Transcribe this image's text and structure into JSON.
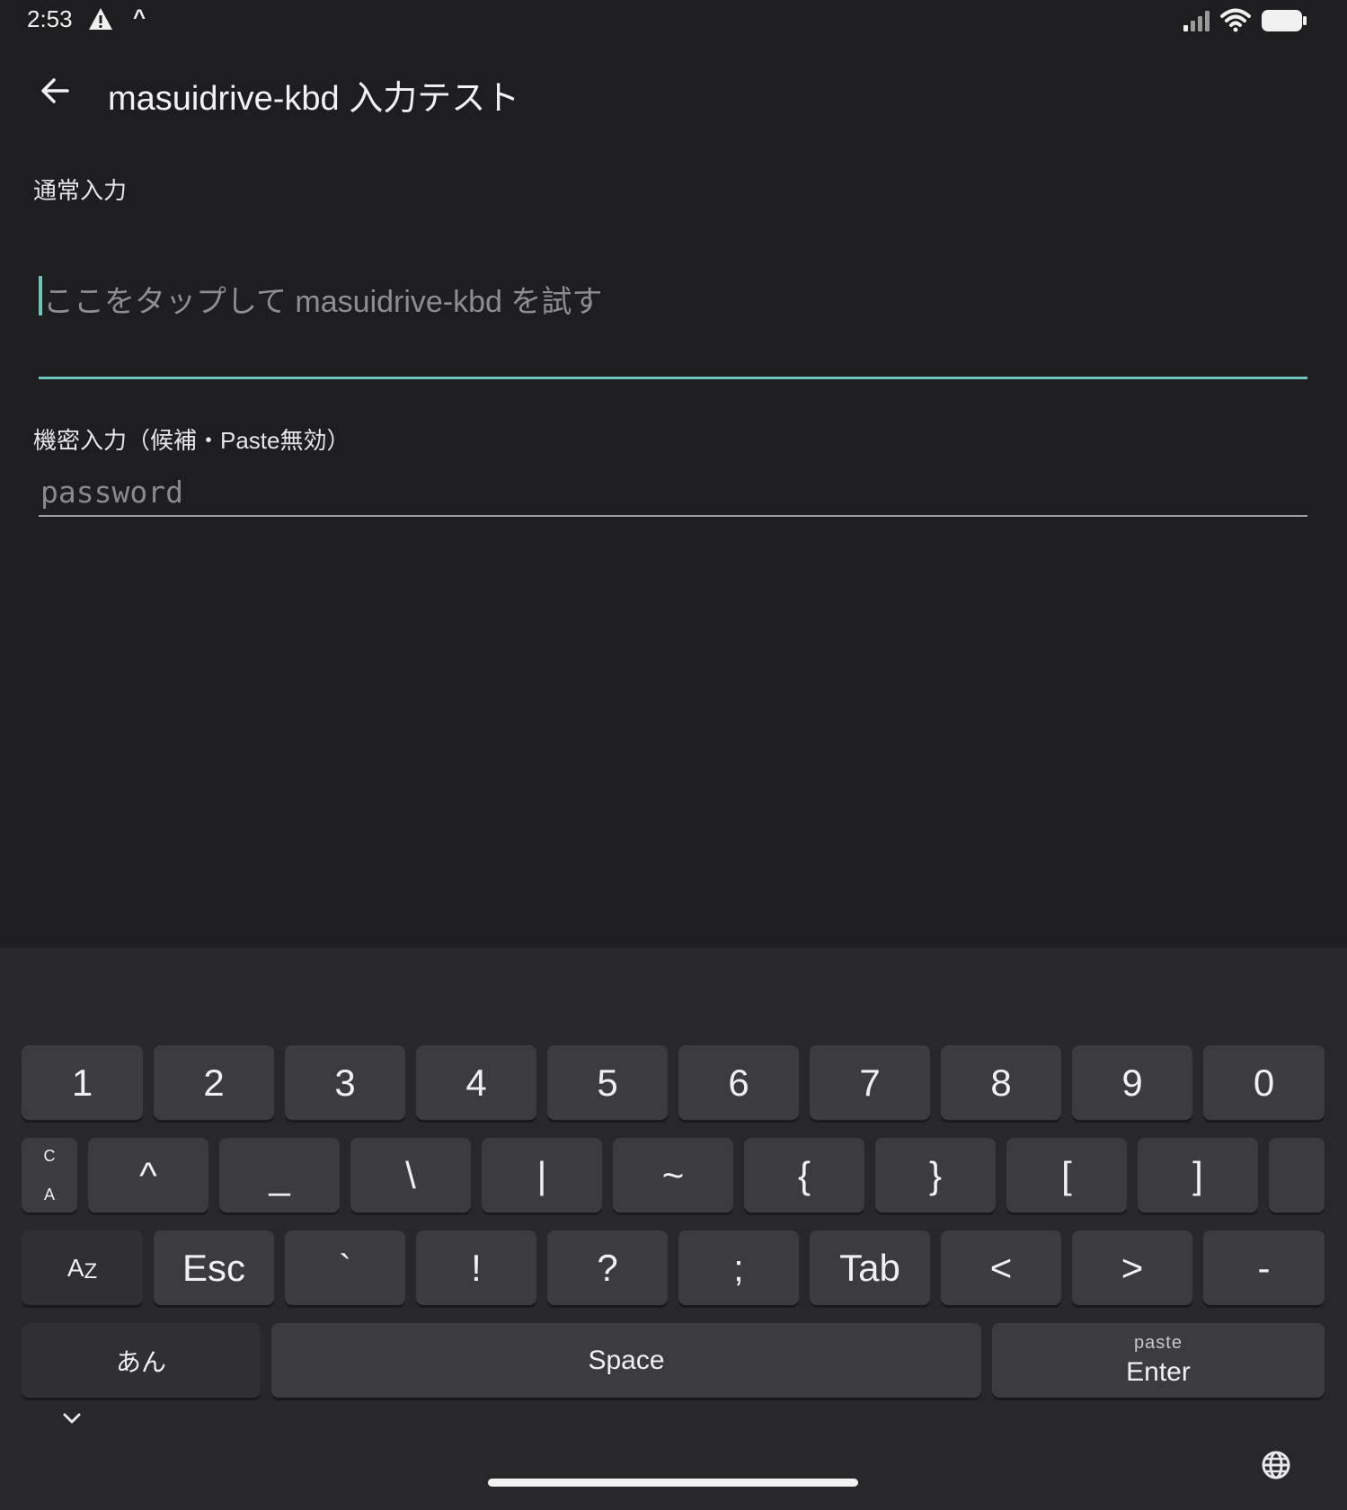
{
  "status_bar": {
    "time": "2:53",
    "caret": "^",
    "icons": [
      "warning-icon",
      "signal-icon",
      "wifi-icon",
      "battery-icon"
    ]
  },
  "app_bar": {
    "title": "masuidrive-kbd 入力テスト",
    "back_icon": "arrow-back-icon"
  },
  "form": {
    "normal_label": "通常入力",
    "normal_placeholder": "ここをタップして masuidrive-kbd を試す",
    "secret_label": "機密入力（候補・Paste無効）",
    "secret_placeholder": "password"
  },
  "colors": {
    "background": "#1e1e20",
    "accent": "#6cc4bb",
    "keyboard_bg": "#28282a",
    "key_bg": "#3c3c3e"
  },
  "keyboard": {
    "row1": [
      "1",
      "2",
      "3",
      "4",
      "5",
      "6",
      "7",
      "8",
      "9",
      "0"
    ],
    "row2": {
      "ca_top": "C",
      "ca_bottom": "A",
      "keys": [
        "^",
        "_",
        "\\",
        "|",
        "~",
        "{",
        "}",
        "[",
        "]",
        ""
      ]
    },
    "row3": {
      "az_a": "A",
      "az_z": "Z",
      "keys": [
        "Esc",
        "`",
        "!",
        "?",
        ";",
        "Tab",
        "<",
        ">",
        "-"
      ]
    },
    "row4": {
      "kana": "あん",
      "space": "Space",
      "enter_sub": "paste",
      "enter": "Enter"
    },
    "nav_icons": [
      "chevron-down-icon",
      "globe-icon"
    ]
  }
}
